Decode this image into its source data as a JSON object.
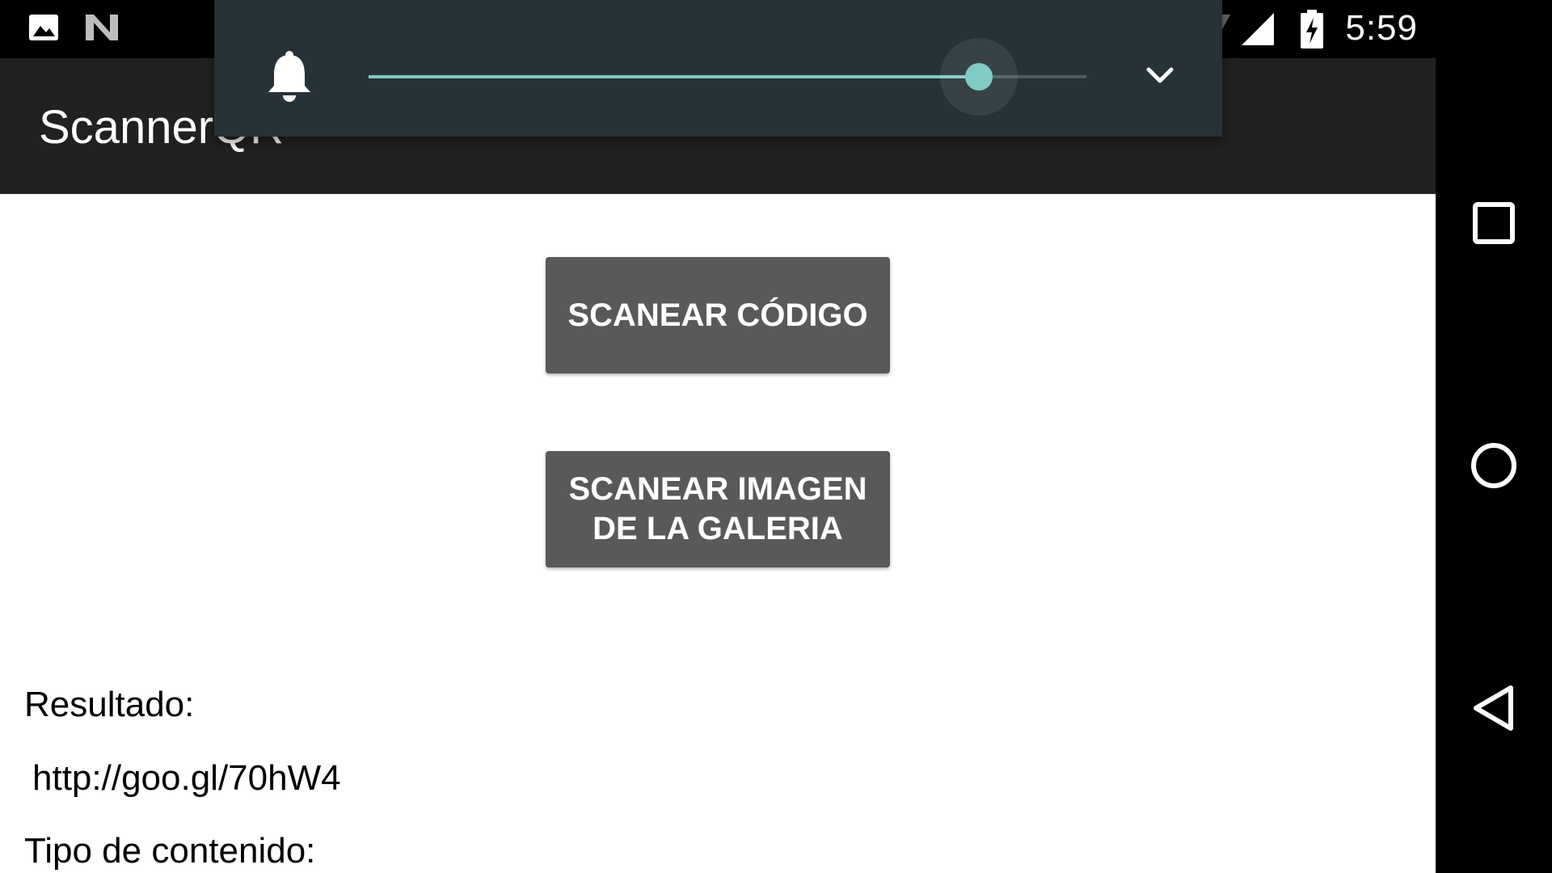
{
  "status_bar": {
    "left_icons": [
      "image-icon",
      "n-logo-icon"
    ],
    "right_icons": [
      "wifi-icon",
      "signal-icon",
      "battery-charging-icon"
    ],
    "time": "5:59"
  },
  "app_bar": {
    "title": "ScannerQR"
  },
  "volume_panel": {
    "icon": "bell-icon",
    "level_fraction": 0.85,
    "accent_color": "#80cbc4",
    "expand_icon": "chevron-down-icon"
  },
  "main": {
    "scan_code_button": "SCANEAR CÓDIGO",
    "scan_gallery_button": {
      "line1": "SCANEAR IMAGEN",
      "line2": "DE LA GALERIA"
    },
    "result_label": "Resultado:",
    "result_value": "http://goo.gl/70hW4",
    "content_type_label": "Tipo de contenido:"
  },
  "nav_bar": {
    "buttons": [
      "recents-square-icon",
      "home-circle-icon",
      "back-triangle-icon"
    ]
  },
  "colors": {
    "status_bar": "#000000",
    "app_bar": "#212121",
    "button": "#595959",
    "volume_panel": "#263238"
  }
}
